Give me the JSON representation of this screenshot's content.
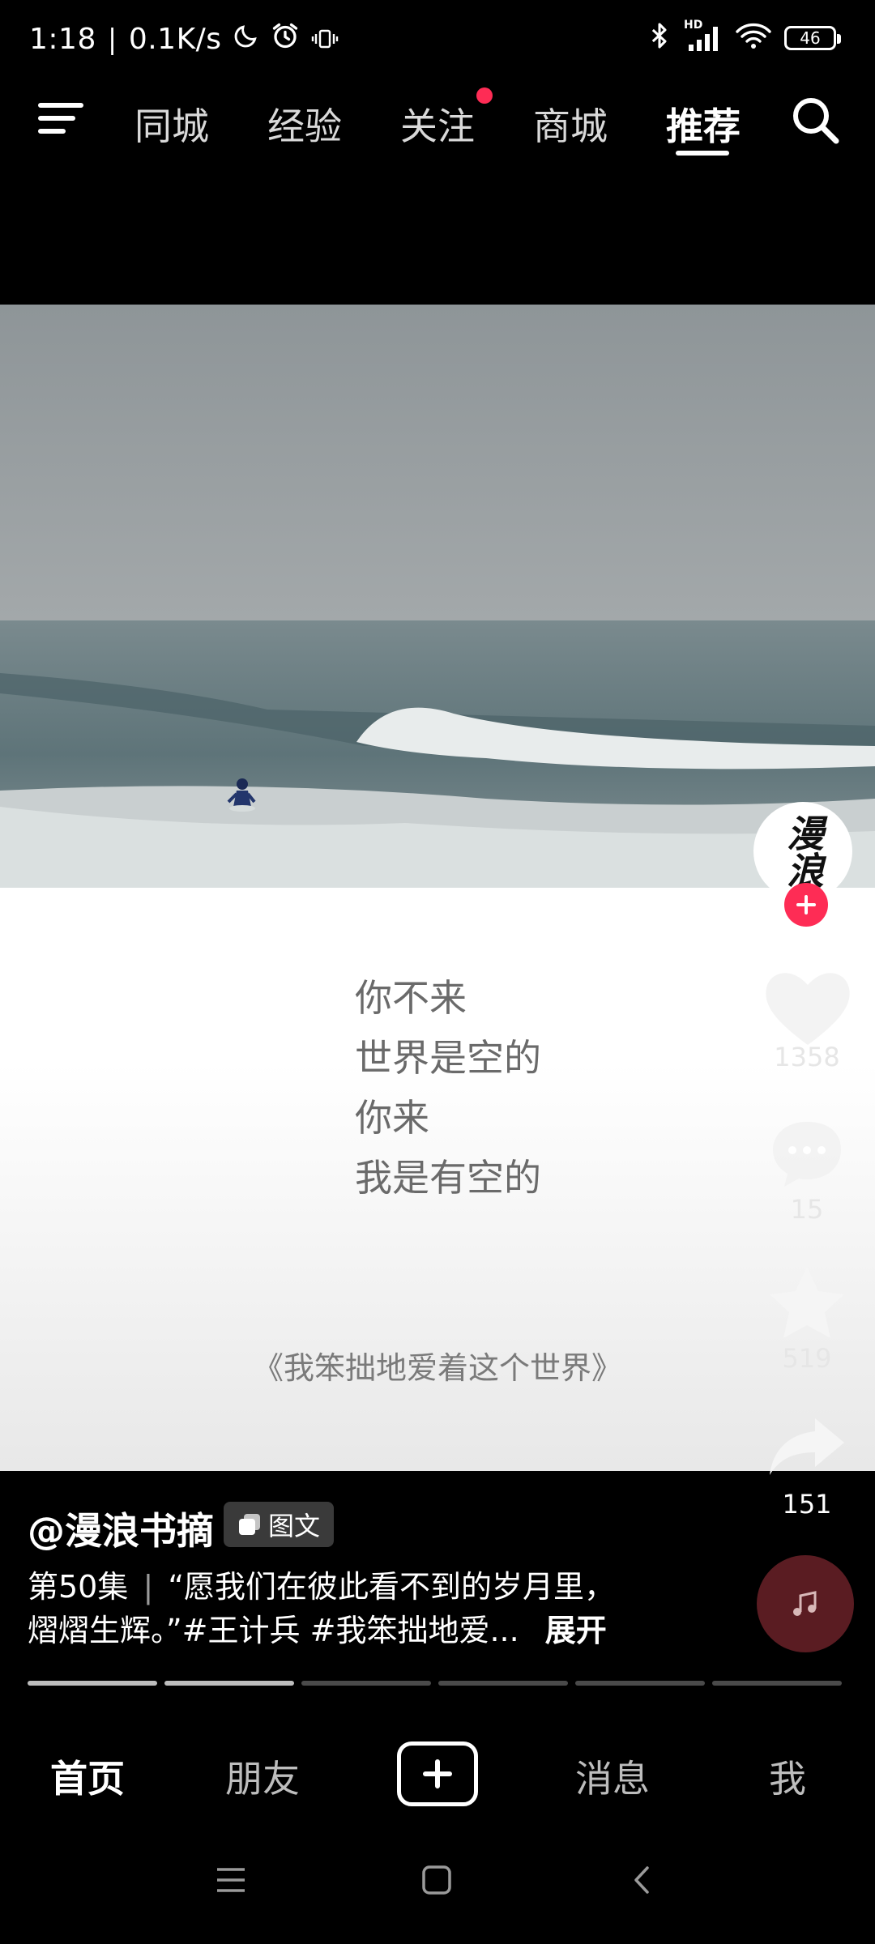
{
  "status_bar": {
    "time": "1:18",
    "network_speed": "0.1K/s",
    "signal_label": "HD",
    "battery": "46"
  },
  "top_nav": {
    "tabs": [
      {
        "label": "同城"
      },
      {
        "label": "经验"
      },
      {
        "label": "关注"
      },
      {
        "label": "商城"
      },
      {
        "label": "推荐"
      }
    ],
    "active_tab": "推荐"
  },
  "post": {
    "quote_lines": [
      "你不来",
      "世界是空的",
      "你来",
      "我是有空的"
    ],
    "book_title": "《我笨拙地爱着这个世界》",
    "avatar_text": "漫浪",
    "likes": "1358",
    "comments": "15",
    "favorites": "519",
    "shares": "151",
    "author": "@漫浪书摘",
    "type_badge": "图文",
    "episode": "第50集",
    "caption_line1": "“愿我们在彼此看不到的岁月里，",
    "caption_line2": "熠熠生辉。”#王计兵 #我笨拙地爱...",
    "expand_label": "展开",
    "progress": {
      "total_segments": 6,
      "viewed_segments": 2
    }
  },
  "bottom_nav": {
    "items": [
      {
        "label": "首页"
      },
      {
        "label": "朋友"
      },
      {
        "label": "消息"
      },
      {
        "label": "我"
      }
    ]
  },
  "colors": {
    "accent": "#fe2c55",
    "background": "#000000"
  }
}
